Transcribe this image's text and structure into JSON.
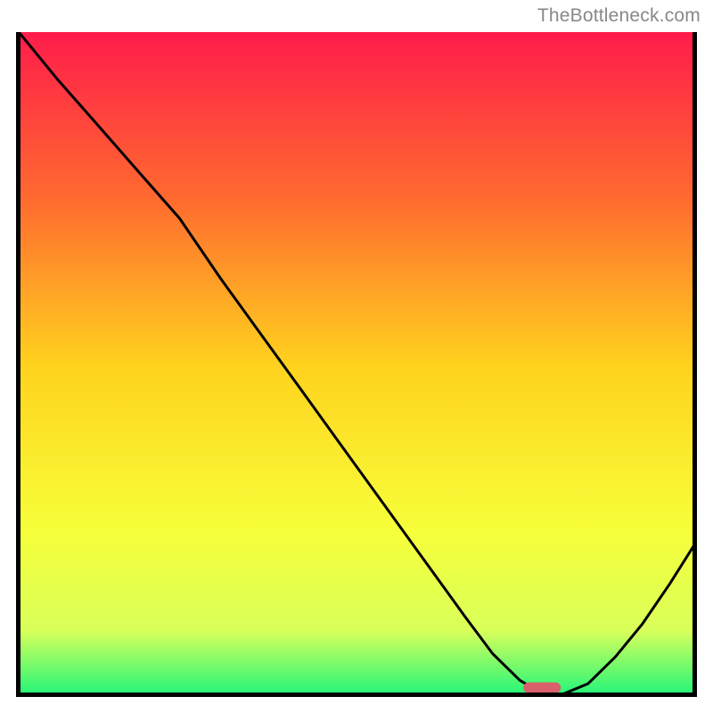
{
  "watermark": "TheBottleneck.com",
  "chart_data": {
    "type": "line",
    "title": "",
    "xlabel": "",
    "ylabel": "",
    "xlim": [
      0,
      100
    ],
    "ylim": [
      0,
      100
    ],
    "grid": false,
    "legend": false,
    "gradient_stops": [
      {
        "offset": 0,
        "color": "#ff1c4b"
      },
      {
        "offset": 25,
        "color": "#ff6a2f"
      },
      {
        "offset": 50,
        "color": "#ffd21e"
      },
      {
        "offset": 75,
        "color": "#f7ff3a"
      },
      {
        "offset": 90,
        "color": "#d9ff5a"
      },
      {
        "offset": 100,
        "color": "#1ef57a"
      }
    ],
    "curve": {
      "x": [
        0.4,
        6,
        12,
        18,
        24,
        30,
        36,
        42,
        48,
        54,
        60,
        66,
        70,
        74,
        77,
        80,
        84,
        88,
        92,
        96,
        100
      ],
      "y": [
        100,
        93,
        86,
        79,
        72,
        63,
        54.5,
        46,
        37.5,
        29,
        20.5,
        12,
        6.5,
        2.5,
        0.7,
        0.3,
        2,
        6,
        11,
        17,
        23.5
      ]
    },
    "marker": {
      "x_start": 74.5,
      "x_end": 80,
      "y": 1.4,
      "color": "#d9606a"
    }
  }
}
